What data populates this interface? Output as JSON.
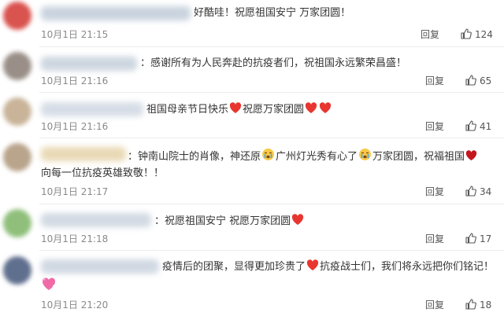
{
  "comments": [
    {
      "text": "好酷哇！祝愿祖国安宁 万家团圆！",
      "time": "10月1日 21:15",
      "reply": "回复",
      "likes": "124"
    },
    {
      "text": "：感谢所有为人民奔赴的抗疫者们，祝祖国永远繁荣昌盛！",
      "time": "10月1日 21:16",
      "reply": "回复",
      "likes": "65"
    },
    {
      "text_a": "祖国母亲节日快乐",
      "text_b": "祝愿万家团圆",
      "time": "10月1日 21:16",
      "reply": "回复",
      "likes": "41"
    },
    {
      "text_a": "：钟南山院士的肖像，神还原",
      "text_b": "广州灯光秀有心了",
      "text_c": "万家团圆，祝福祖国",
      "text_line2": "向每一位抗疫英雄致敬！！",
      "time": "10月1日 21:17",
      "reply": "回复",
      "likes": "34"
    },
    {
      "text": "：祝愿祖国安宁 祝愿万家团圆",
      "time": "10月1日 21:18",
      "reply": "回复",
      "likes": "17"
    },
    {
      "text_a": "疫情后的团聚，显得更加珍贵了",
      "text_b": "抗疫战士们，我们将永远把你们铭记！",
      "time": "10月1日 21:20",
      "reply": "回复",
      "likes": "18"
    }
  ],
  "colors": {
    "heart": "#e8352f",
    "text": "#333333",
    "meta": "#8a8a8a"
  }
}
